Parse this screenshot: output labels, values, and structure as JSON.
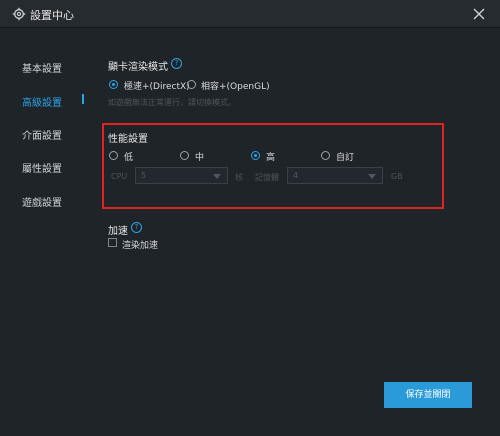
{
  "window": {
    "title": "設置中心",
    "icons": {
      "settings": "gear-icon",
      "close": "close-icon"
    }
  },
  "sidebar": {
    "active_index": 1,
    "items": [
      {
        "label": "基本設置"
      },
      {
        "label": "高級設置"
      },
      {
        "label": "介面設置"
      },
      {
        "label": "屬性設置"
      },
      {
        "label": "遊戲設置"
      }
    ]
  },
  "render": {
    "label": "顯卡渲染模式",
    "help": "?",
    "options": [
      {
        "label": "極速+(DirectX)",
        "selected": true
      },
      {
        "label": "相容+(OpenGL)",
        "selected": false
      }
    ],
    "hint": "如遊戲無法正常運行，請切換模式。"
  },
  "performance": {
    "label": "性能設置",
    "options": [
      {
        "label": "低",
        "selected": false
      },
      {
        "label": "中",
        "selected": false
      },
      {
        "label": "高",
        "selected": true
      },
      {
        "label": "自訂",
        "selected": false
      }
    ],
    "cpu_label": "CPU",
    "cpu_value": "5",
    "cpu_unit": "核",
    "memory_label": "記憶體",
    "memory_value": "4",
    "memory_unit": "GB"
  },
  "acceleration": {
    "label": "加速",
    "help": "?",
    "checkbox_label": "渲染加速",
    "checked": false
  },
  "actions": {
    "save_label": "保存並關閉"
  },
  "colors": {
    "accent": "#2ba3e6",
    "highlight_box": "#e02424",
    "button": "#2a9bd8",
    "background": "#1f2428"
  }
}
